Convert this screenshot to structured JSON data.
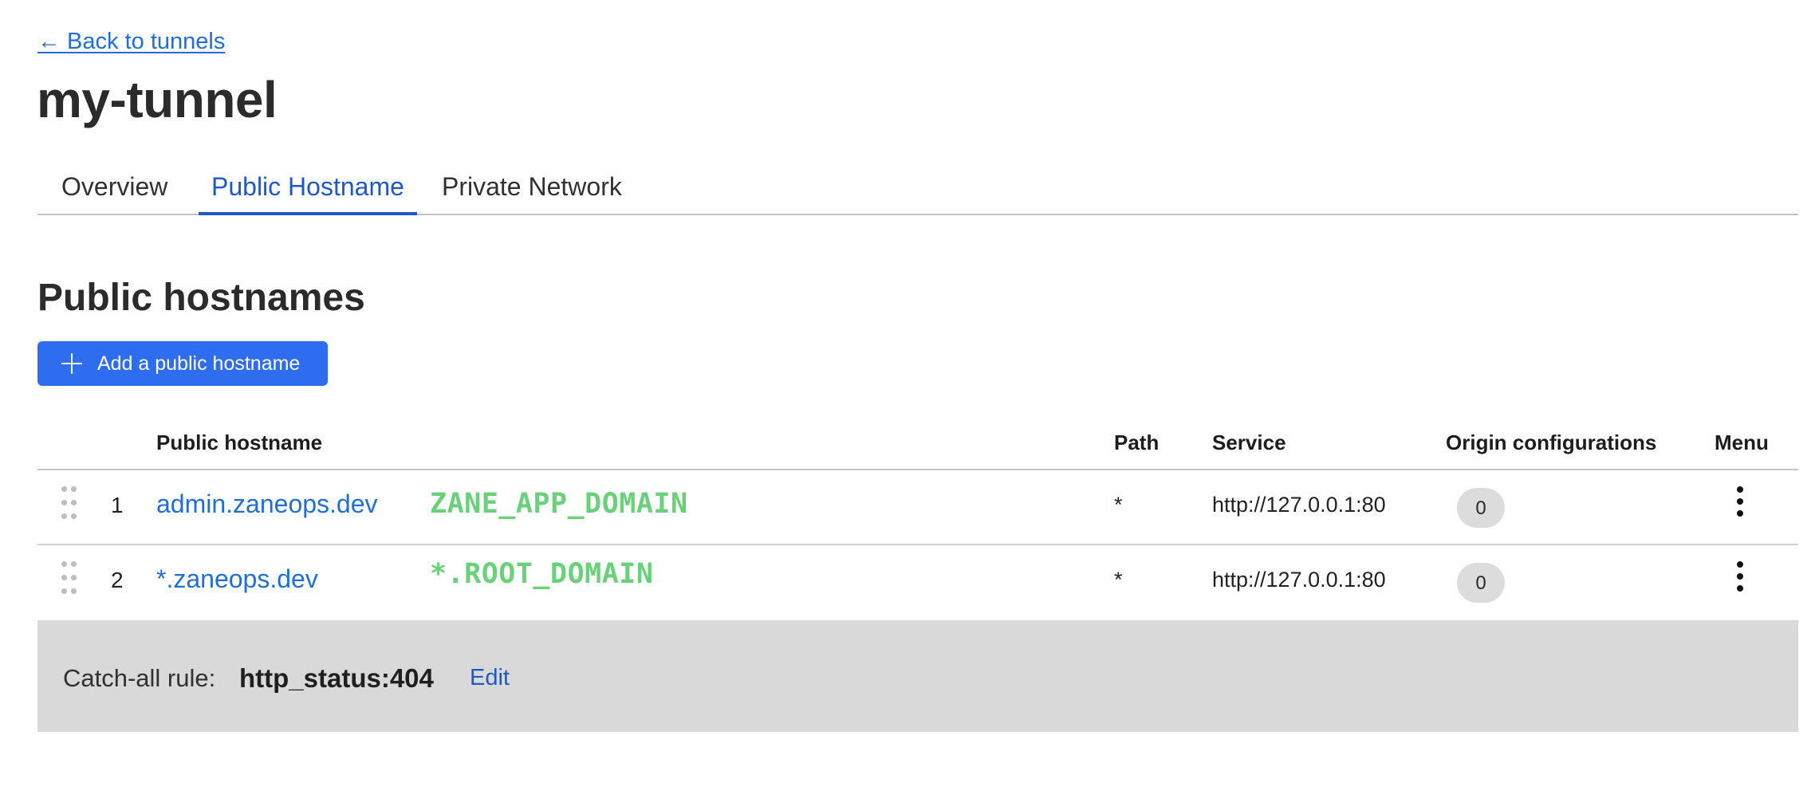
{
  "nav": {
    "back_label": "← Back to tunnels"
  },
  "tunnel": {
    "name": "my-tunnel"
  },
  "tabs": [
    {
      "label": "Overview",
      "active": false
    },
    {
      "label": "Public Hostname",
      "active": true
    },
    {
      "label": "Private Network",
      "active": false
    }
  ],
  "section": {
    "title": "Public hostnames",
    "add_button_label": "Add a public hostname"
  },
  "table": {
    "headers": {
      "hostname": "Public hostname",
      "path": "Path",
      "service": "Service",
      "origin": "Origin configurations",
      "menu": "Menu"
    },
    "rows": [
      {
        "index": "1",
        "hostname": "admin.zaneops.dev",
        "annotation": "ZANE_APP_DOMAIN",
        "path": "*",
        "service": "http://127.0.0.1:80",
        "origin_count": "0"
      },
      {
        "index": "2",
        "hostname": "*.zaneops.dev",
        "annotation": "*.ROOT_DOMAIN",
        "path": "*",
        "service": "http://127.0.0.1:80",
        "origin_count": "0"
      }
    ]
  },
  "catch_all": {
    "label": "Catch-all rule:",
    "value": "http_status:404",
    "edit_label": "Edit"
  },
  "colors": {
    "accent": "#1f58c7",
    "link": "#1f6fd6",
    "primary_button": "#2f6df0",
    "annotation": "#6ad17b",
    "catch_all_bg": "#d9d9d9"
  },
  "icons": [
    "plus-icon",
    "drag-handle-icon",
    "kebab-menu-icon"
  ]
}
